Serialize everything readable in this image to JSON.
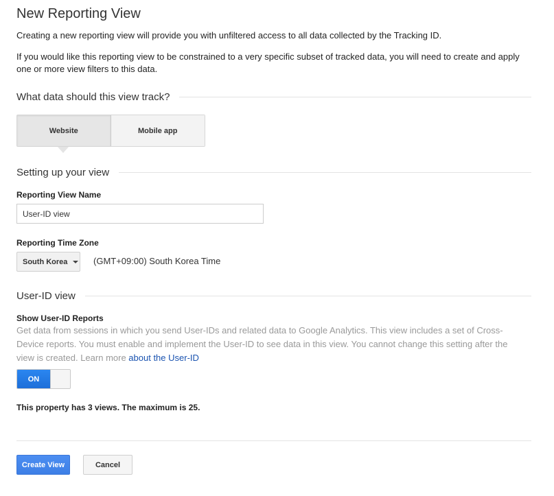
{
  "page": {
    "title": "New Reporting View",
    "intro": "Creating a new reporting view will provide you with unfiltered access to all data collected by the Tracking ID.",
    "filter_note": "If you would like this reporting view to be constrained to a very specific subset of tracked data, you will need to create and apply one or more view filters to this data."
  },
  "track_section": {
    "heading": "What data should this view track?",
    "options": [
      "Website",
      "Mobile app"
    ],
    "selected": "Website"
  },
  "setup_section": {
    "heading": "Setting up your view",
    "view_name_label": "Reporting View Name",
    "view_name_value": "User-ID view",
    "time_zone_label": "Reporting Time Zone",
    "time_zone_country": "South Korea",
    "time_zone_value": "(GMT+09:00) South Korea Time"
  },
  "userid_section": {
    "heading": "User-ID view",
    "reports_label": "Show User-ID Reports",
    "description": "Get data from sessions in which you send User-IDs and related data to Google Analytics. This view includes a set of Cross-Device reports. You must enable and implement the User-ID to see data in this view. You cannot change this setting after the view is created. Learn more ",
    "learn_more_link": "about the User-ID",
    "toggle_state": "ON"
  },
  "views_note": "This property has 3 views. The maximum is 25.",
  "actions": {
    "create_label": "Create View",
    "cancel_label": "Cancel"
  },
  "colors": {
    "primary_button": "#4285f4",
    "toggle_on": "#1a73e8",
    "link": "#1a53b0",
    "muted_text": "#999999"
  }
}
